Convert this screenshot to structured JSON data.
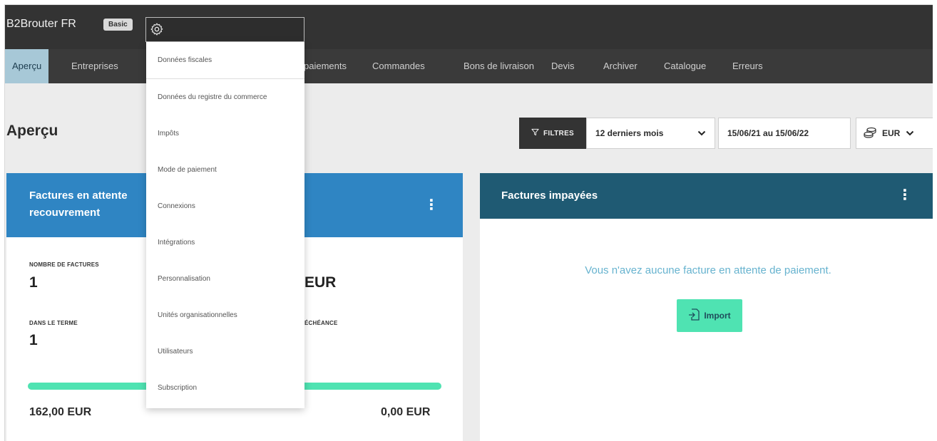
{
  "app": {
    "brand": "B2Brouter FR",
    "plan_badge": "Basic"
  },
  "nav": [
    {
      "label": "Aperçu",
      "active": true
    },
    {
      "label": "Entreprises",
      "active": false
    },
    {
      "label": "paiements",
      "active": false
    },
    {
      "label": "Commandes",
      "active": false
    },
    {
      "label": "Bons de livraison",
      "active": false
    },
    {
      "label": "Devis",
      "active": false
    },
    {
      "label": "Archiver",
      "active": false
    },
    {
      "label": "Catalogue",
      "active": false
    },
    {
      "label": "Erreurs",
      "active": false
    }
  ],
  "settings_menu": {
    "icon": "gear-icon",
    "items": [
      "Données fiscales",
      "Données du registre du commerce",
      "Impôts",
      "Mode de paiement",
      "Connexions",
      "Intégrations",
      "Personnalisation",
      "Unités organisationnelles",
      "Utilisateurs",
      "Subscription"
    ]
  },
  "page": {
    "title": "Aperçu"
  },
  "filters": {
    "button_label": "FILTRES",
    "period": "12 derniers mois",
    "date_range": "15/06/21 au 15/06/22",
    "currency": "EUR"
  },
  "pending_card": {
    "title_line1": "Factures en attente",
    "title_line2": "recouvrement",
    "invoice_count_label": "NOMBRE DE FACTURES",
    "invoice_count": "1",
    "total_partial": "EUR",
    "in_term_label": "DANS LE TERME",
    "in_term_value": "1",
    "overdue_label_partial": "ÉCHÉANCE",
    "progress_fraction": 1.0,
    "amount_left": "162,00 EUR",
    "amount_right": "0,00 EUR"
  },
  "unpaid_card": {
    "title": "Factures impayées",
    "empty_message": "Vous n'avez aucune facture en attente de paiement.",
    "import_label": "Import"
  },
  "colors": {
    "topbar": "#333333",
    "nav_active": "#a7c8d7",
    "pending_header": "#2f85c3",
    "unpaid_header": "#1f5a73",
    "accent_green": "#4fe3b2"
  }
}
